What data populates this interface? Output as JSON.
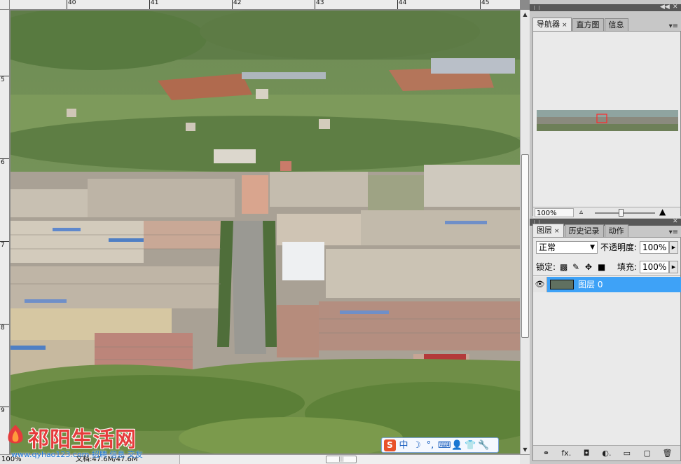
{
  "canvas": {
    "ruler_top_labels": [
      "40",
      "41",
      "42",
      "43",
      "44",
      "45"
    ],
    "ruler_left_labels": [
      "5",
      "6",
      "7",
      "8",
      "9"
    ],
    "zoom": "100%",
    "doc_info": "文档:47.6M/47.6M"
  },
  "watermark": {
    "brand": "祁阳生活网",
    "url": "www.qyhao123.com 招聘 信息 交友"
  },
  "ime": {
    "logo": "S",
    "buttons": [
      "中",
      "☽",
      "°,",
      "⌨",
      "👤",
      "👕",
      "🔧"
    ],
    "button_names": [
      "ime-chinese-mode",
      "ime-halfwidth-icon",
      "ime-punctuation-icon",
      "ime-keyboard-icon",
      "ime-user-icon",
      "ime-skin-icon",
      "ime-tools-icon"
    ]
  },
  "navigator_panel": {
    "tabs": [
      {
        "label": "导航器",
        "close": "×",
        "active": true
      },
      {
        "label": "直方图",
        "active": false
      },
      {
        "label": "信息",
        "active": false
      }
    ],
    "zoom_value": "100%",
    "colors": {
      "view_box": "#ff2a2a"
    }
  },
  "layers_panel": {
    "tabs": [
      {
        "label": "图层",
        "close": "×",
        "active": true
      },
      {
        "label": "历史记录",
        "active": false
      },
      {
        "label": "动作",
        "active": false
      }
    ],
    "blend_mode": "正常",
    "opacity_label": "不透明度:",
    "opacity_value": "100%",
    "lock_label": "锁定:",
    "fill_label": "填充:",
    "fill_value": "100%",
    "layer_name": "图层 0",
    "footer_buttons": [
      "⚭",
      "fx.",
      "◘",
      "◐.",
      "▭",
      "▢",
      "🗑"
    ],
    "footer_names": [
      "link-layers-icon",
      "fx-icon",
      "mask-icon",
      "adjustment-icon",
      "group-icon",
      "new-layer-icon",
      "trash-icon"
    ],
    "colors": {
      "selected_row": "#3ea2f7"
    }
  }
}
